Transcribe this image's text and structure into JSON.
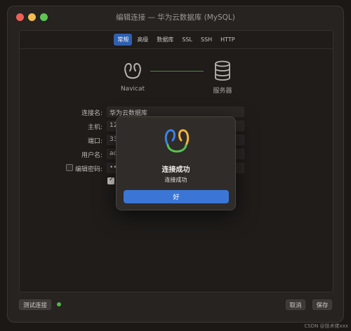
{
  "window": {
    "title": "编辑连接 — 华为云数据库 (MySQL)"
  },
  "tabs": [
    "常规",
    "高级",
    "数据库",
    "SSL",
    "SSH",
    "HTTP"
  ],
  "active_tab": "常规",
  "connection_visual": {
    "client_label": "Navicat",
    "server_label": "服务器"
  },
  "form": {
    "connection_name": {
      "label": "连接名:",
      "value": "华为云数据库"
    },
    "host": {
      "label": "主机:",
      "value": "12"
    },
    "port": {
      "label": "端口:",
      "value": "33"
    },
    "username": {
      "label": "用户名:",
      "value": "ad"
    },
    "password": {
      "label": "编辑密码:",
      "value": "••"
    }
  },
  "bottom": {
    "test_label": "测试连接",
    "cancel_label": "取消",
    "save_label": "保存"
  },
  "status_color": "#4fb548",
  "dialog": {
    "title": "连接成功",
    "message": "连接成功",
    "ok_label": "好"
  },
  "watermark": "CSDN @技术佬xxx",
  "icons": {
    "app_logo": "navicat-logo-icon",
    "server": "database-icon"
  },
  "colors": {
    "accent": "#3b76d6",
    "tab_active": "#2f5fb0"
  }
}
